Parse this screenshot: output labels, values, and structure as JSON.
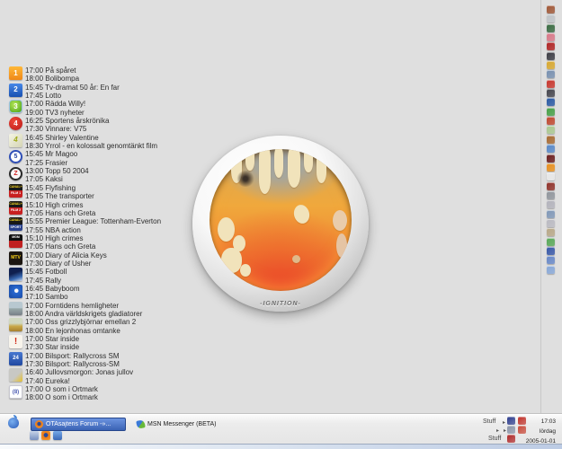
{
  "orb": {
    "label": "-IGNITION-"
  },
  "taskbar": {
    "chevron": "▸",
    "tasks": [
      {
        "id": "forum",
        "label": "OTAsajtens Forum -»...",
        "icon": "firefox-icon",
        "active": true
      },
      {
        "id": "msn",
        "label": "MSN Messenger (BETA)",
        "icon": "msn-butterfly-icon",
        "active": false
      }
    ],
    "quick_launch": [
      {
        "name": "window-icon",
        "bg": "linear-gradient(180deg,#c8d4e8,#7890c0)"
      },
      {
        "name": "firefox-icon",
        "bg": "radial-gradient(circle at 50% 45%,#2a4a9a 30%,#e87818 34%,#f8a030)"
      },
      {
        "name": "folder-icon",
        "bg": "linear-gradient(180deg,#78aae8,#3a68b8)"
      }
    ],
    "toolbars": [
      {
        "label": "Stuff"
      },
      {
        "label": "Stuff"
      }
    ],
    "tray": [
      {
        "name": "tray-icon-1",
        "color": "#2a3a8c"
      },
      {
        "name": "tray-icon-2",
        "color": "#c03028"
      },
      {
        "name": "tray-icon-3",
        "color": "#8a94a8"
      },
      {
        "name": "tray-icon-4",
        "color": "#c84838"
      },
      {
        "name": "tray-icon-5",
        "color": "#b02828"
      }
    ],
    "clock": {
      "time": "17:03",
      "day": "lördag",
      "date": "2005-01-01"
    }
  },
  "tv_listing": {
    "channels": [
      {
        "id": "svt1",
        "icon": {
          "glyph": "1",
          "bg": "linear-gradient(180deg,#ffb838,#f08818)",
          "fg": "#fff",
          "shape": "square"
        },
        "lines": [
          "17:00 På spåret",
          "18:00 Bolibompa"
        ]
      },
      {
        "id": "svt2",
        "icon": {
          "glyph": "2",
          "bg": "linear-gradient(180deg,#4888e8,#1850b0)",
          "fg": "#fff",
          "shape": "square"
        },
        "lines": [
          "15:45 Tv-dramat 50 år: En far",
          "17:45 Lotto"
        ]
      },
      {
        "id": "tv3",
        "icon": {
          "glyph": "3",
          "bg": "radial-gradient(circle at 40% 35%,#b8e858,#48a018)",
          "fg": "#fff",
          "shape": "rounded",
          "border": "1px solid #9cc2e6"
        },
        "lines": [
          "17:00 Rädda Willy!",
          "19:00 TV3 nyheter"
        ]
      },
      {
        "id": "tv4",
        "icon": {
          "glyph": "4",
          "bg": "radial-gradient(circle at 40% 35%,#f04838,#b81818)",
          "fg": "#fff",
          "shape": "circle"
        },
        "lines": [
          "16:25 Sportens årskrönika",
          "17:30 Vinnare: V75"
        ]
      },
      {
        "id": "tv4-plus",
        "icon": {
          "glyph": "4",
          "bg": "linear-gradient(135deg,#f4f4e4,#d4d4b4)",
          "fg": "#a0aa18",
          "shape": "square",
          "italic": true
        },
        "lines": [
          "16:45 Shirley Valentine",
          "18:30 Yrrol - en kolossalt genomtänkt film"
        ]
      },
      {
        "id": "kanal5",
        "icon": {
          "glyph": "5",
          "bg": "#ffffff",
          "fg": "#2040a0",
          "shape": "circle",
          "border": "2px solid #3050b8",
          "fs": 7
        },
        "lines": [
          "15:45 Mr Magoo",
          "17:25 Frasier"
        ]
      },
      {
        "id": "ztv",
        "icon": {
          "glyph": "Z",
          "bg": "#f8f8f8",
          "fg": "#d02020",
          "shape": "circle",
          "border": "2px solid #2a2a2a",
          "fs": 7
        },
        "lines": [
          "13:00 Topp 50 2004",
          "17:05 Kaksi"
        ]
      },
      {
        "id": "canal-plus-film1",
        "icon": {
          "bands": [
            {
              "text": "CANAL+",
              "bg": "#181818",
              "fg": "#f8d820"
            },
            {
              "text": "FILM 1",
              "bg": "#c82020",
              "fg": "#ffffff"
            }
          ]
        },
        "lines": [
          "15:45 Flyfishing",
          "17:05 The transporter"
        ]
      },
      {
        "id": "canal-plus-film2",
        "icon": {
          "bands": [
            {
              "text": "CANAL+",
              "bg": "#181818",
              "fg": "#f8d820"
            },
            {
              "text": "FILM 2",
              "bg": "#c82020",
              "fg": "#ffffff"
            }
          ]
        },
        "lines": [
          "15:10 High crimes",
          "17:05 Hans och Greta"
        ]
      },
      {
        "id": "canal-plus-sport",
        "icon": {
          "bands": [
            {
              "text": "CANAL+",
              "bg": "#181818",
              "fg": "#f8d820"
            },
            {
              "text": "SPORT",
              "bg": "#28408c",
              "fg": "#ffffff"
            }
          ]
        },
        "lines": [
          "15:55 Premier League: Tottenham-Everton",
          "17:55 NBA action"
        ]
      },
      {
        "id": "mgm",
        "icon": {
          "bands": [
            {
              "text": "MGM",
              "bg": "#101010",
              "fg": "#ffffff"
            },
            {
              "text": "",
              "bg": "#c02020",
              "fg": "#ffffff"
            }
          ]
        },
        "lines": [
          "15:10 High crimes",
          "17:05 Hans och Greta"
        ]
      },
      {
        "id": "mtv",
        "icon": {
          "glyph": "MTV",
          "bg": "#1c1610",
          "fg": "#f8d018",
          "shape": "square",
          "fs": 5
        },
        "lines": [
          "17:00 Diary of Alicia Keys",
          "17:30 Diary of Usher"
        ]
      },
      {
        "id": "eurosport",
        "icon": {
          "glyph": "",
          "bg": "linear-gradient(160deg,#0f1f4e 40%,#3868b0 72%,#c8d8f0)",
          "shape": "square"
        },
        "lines": [
          "15:45 Fotboll",
          "17:45 Rally"
        ]
      },
      {
        "id": "channel-14",
        "icon": {
          "glyph": "",
          "bg": "radial-gradient(circle at 55% 45%,#f8f8f8 17%,#2868d0 22%,#1848a0)",
          "shape": "square"
        },
        "lines": [
          "16:45 Babyboom",
          "17:10 Sambo"
        ]
      },
      {
        "id": "discovery",
        "icon": {
          "glyph": "",
          "bg": "linear-gradient(180deg,#b8c8d0 45%,#98a8a8 52%,#788088)",
          "shape": "square"
        },
        "lines": [
          "17:00 Forntidens hemligheter",
          "18:00 Andra världskrigets gladiatorer"
        ]
      },
      {
        "id": "animal-planet",
        "icon": {
          "glyph": "",
          "bg": "linear-gradient(180deg,#d0d8c0 40%,#c8a848 62%,#a88030)",
          "shape": "square"
        },
        "lines": [
          "17:00 Oss grizzlybjörnar emellan 2",
          "18:00 En lejonhonas omtanke"
        ]
      },
      {
        "id": "star",
        "icon": {
          "glyph": "!",
          "bg": "#f8f4ec",
          "fg": "#d02818",
          "shape": "square",
          "fs": 10
        },
        "lines": [
          "17:00 Star inside",
          "17:30 Star inside"
        ]
      },
      {
        "id": "svt24",
        "icon": {
          "glyph": "24",
          "bg": "linear-gradient(180deg,#4878d0,#2048a0)",
          "fg": "#fff",
          "shape": "square",
          "fs": 6
        },
        "lines": [
          "17:00 Bilsport: Rallycross SM",
          "17:30 Bilsport: Rallycross-SM"
        ]
      },
      {
        "id": "barnkanalen",
        "icon": {
          "glyph": "",
          "bg": "linear-gradient(135deg,#c8c8c4 55%,#e8c028)",
          "shape": "square"
        },
        "lines": [
          "16:40 Jullovsmorgon: Jonas jullov",
          "17:40 Eureka!"
        ]
      },
      {
        "id": "tv8",
        "icon": {
          "glyph": "(8)",
          "bg": "#ffffff",
          "fg": "#4858b0",
          "shape": "square",
          "fs": 6,
          "border": "1px solid #c8c8d0"
        },
        "lines": [
          "17:00 O som i Ortmark",
          "18:00 O som i Ortmark"
        ]
      }
    ]
  },
  "right_icons": [
    {
      "name": "desktop-shortcut-1",
      "color": "#a05838"
    },
    {
      "name": "desktop-shortcut-2",
      "color": "#c0c4c8"
    },
    {
      "name": "desktop-shortcut-3",
      "color": "#3a6a42"
    },
    {
      "name": "desktop-shortcut-4",
      "color": "#d87888"
    },
    {
      "name": "desktop-shortcut-5",
      "color": "#b02424"
    },
    {
      "name": "desktop-shortcut-6",
      "color": "#3c3c44"
    },
    {
      "name": "desktop-shortcut-7",
      "color": "#d8a830"
    },
    {
      "name": "desktop-shortcut-8",
      "color": "#7890b0"
    },
    {
      "name": "desktop-shortcut-9",
      "color": "#c8372e"
    },
    {
      "name": "desktop-shortcut-10",
      "color": "#46464e"
    },
    {
      "name": "desktop-shortcut-11",
      "color": "#2b5aa4"
    },
    {
      "name": "desktop-shortcut-12",
      "color": "#48a048"
    },
    {
      "name": "desktop-shortcut-13",
      "color": "#c04830"
    },
    {
      "name": "desktop-shortcut-14",
      "color": "#aac890"
    },
    {
      "name": "desktop-shortcut-15",
      "color": "#a86a32"
    },
    {
      "name": "desktop-shortcut-16",
      "color": "#5888c8"
    },
    {
      "name": "desktop-shortcut-17",
      "color": "#6b1d1d"
    },
    {
      "name": "desktop-shortcut-18",
      "color": "#e89020"
    },
    {
      "name": "desktop-shortcut-19",
      "color": "#e8e8e8"
    },
    {
      "name": "desktop-shortcut-20",
      "color": "#90322a"
    },
    {
      "name": "desktop-shortcut-21",
      "color": "#90959c"
    },
    {
      "name": "desktop-shortcut-22",
      "color": "#b3b3bc"
    },
    {
      "name": "desktop-shortcut-23",
      "color": "#8098b8"
    },
    {
      "name": "desktop-shortcut-24",
      "color": "#babac2"
    },
    {
      "name": "desktop-shortcut-25",
      "color": "#b8a888"
    },
    {
      "name": "desktop-shortcut-26",
      "color": "#58a858"
    },
    {
      "name": "desktop-shortcut-27",
      "color": "#3858a8"
    },
    {
      "name": "desktop-shortcut-28",
      "color": "#6888c8"
    },
    {
      "name": "desktop-shortcut-29",
      "color": "#88a8d8"
    }
  ]
}
